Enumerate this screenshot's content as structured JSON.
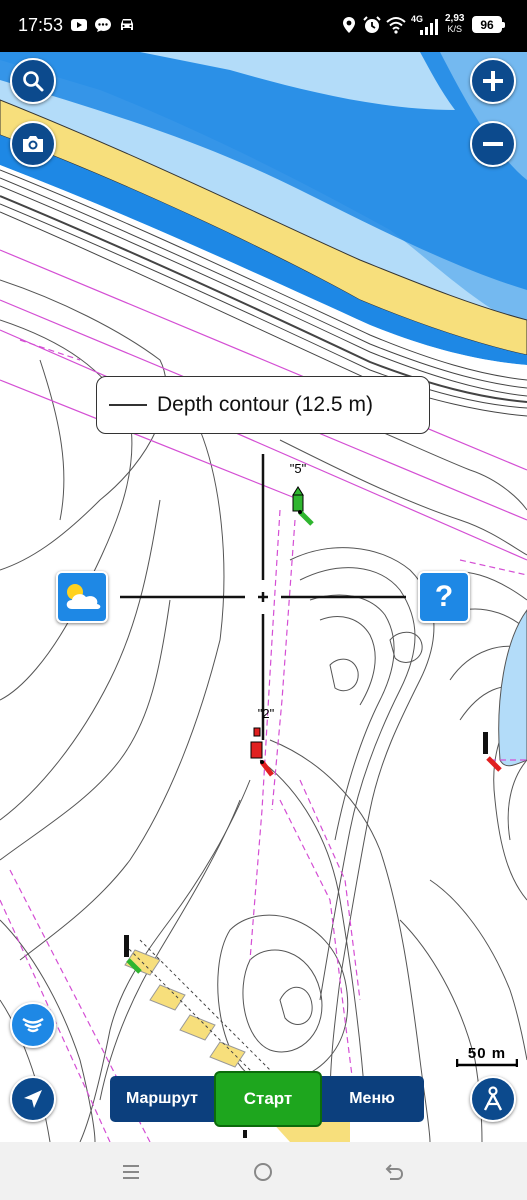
{
  "status_bar": {
    "time": "17:53",
    "network_speed_value": "2,93",
    "network_speed_unit": "K/S",
    "network_type": "4G",
    "battery": "96",
    "left_icons": [
      "youtube-icon",
      "chat-icon",
      "car-icon"
    ],
    "right_icons": [
      "location-icon",
      "alarm-icon",
      "wifi-icon",
      "signal-icon"
    ]
  },
  "map": {
    "info_label": "Depth contour  (12.5 m)",
    "buoy_top_label": "\"5\"",
    "buoy_mid_label": "\"2\"",
    "scale_label": "50 m",
    "colors": {
      "deep_blue": "#1e88e5",
      "mid_blue": "#74b9f0",
      "light_blue": "#b3dcf9",
      "sand": "#f7df7c",
      "contour": "#555555",
      "route_pink": "#d44fd4",
      "marker_red": "#e02020",
      "marker_green": "#2fb52f"
    }
  },
  "controls": {
    "search_icon": "search-icon",
    "camera_icon": "camera-icon",
    "zoom_in_icon": "plus-icon",
    "zoom_out_icon": "minus-icon",
    "weather_icon": "weather-icon",
    "help_label": "?",
    "sonar_icon": "sonar-icon",
    "location_icon": "navigation-arrow-icon",
    "anchor_icon": "anchor-mode-icon"
  },
  "toolbar": {
    "route_label": "Маршрут",
    "start_label": "Старт",
    "menu_label": "Меню"
  },
  "nav_bar": {
    "icons": [
      "recent-apps-icon",
      "home-icon",
      "back-icon"
    ]
  }
}
